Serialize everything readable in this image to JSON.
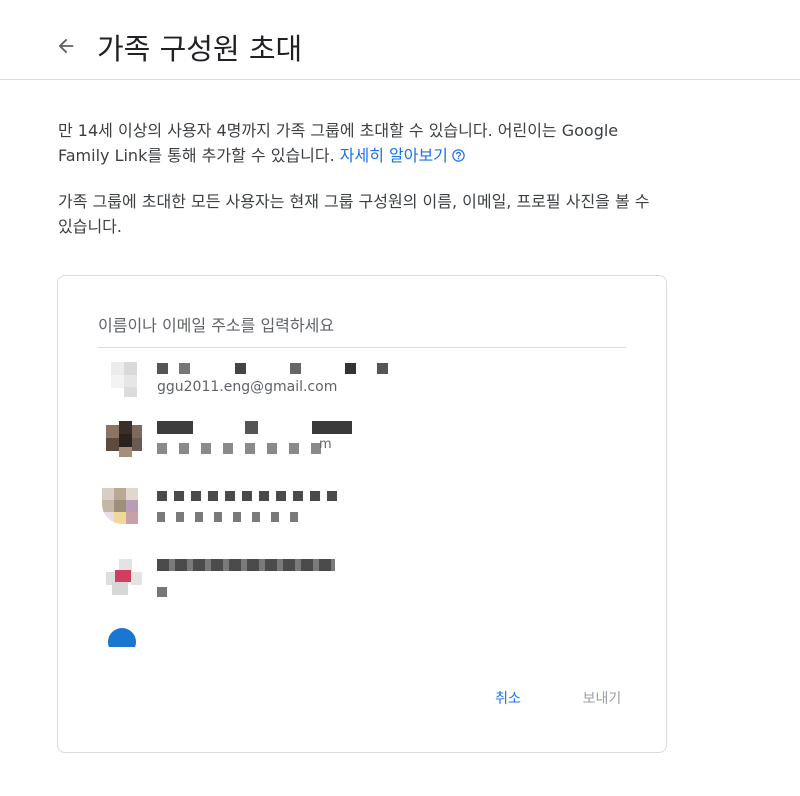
{
  "header": {
    "back_label": "←",
    "title": "가족 구성원 초대"
  },
  "intro": {
    "text": "만 14세 이상의 사용자 4명까지 가족 그룹에 초대할 수 있습니다. 어린이는 Google Family Link를 통해 추가할 수 있습니다.",
    "link_label": "자세히 알아보기"
  },
  "notice": {
    "text": "가족 그룹에 초대한 모든 사용자는 현재 그룹 구성원의 이름, 이메일, 프로필 사진을 볼 수 있습니다."
  },
  "invite_card": {
    "search_placeholder": "이름이나 이메일 주소를 입력하세요",
    "contacts": [
      {
        "email": "ggu2011.eng@gmail.com"
      },
      {
        "email": "m"
      },
      {
        "email": ""
      },
      {
        "email": ""
      },
      {
        "email": ""
      }
    ],
    "cancel_label": "취소",
    "send_label": "보내기"
  },
  "colors": {
    "accent": "#1a73e8",
    "disabled": "#9aa0a6",
    "divider": "#dadce0"
  }
}
